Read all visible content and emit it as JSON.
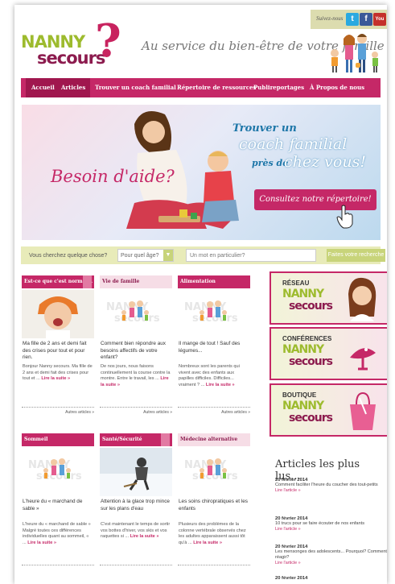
{
  "header": {
    "logo_line1": "NANNY",
    "logo_line2": "secours",
    "logo_mark": "?",
    "tagline": "Au service du bien-être de votre famille",
    "follow_label": "Suivez-nous",
    "social": [
      {
        "icon": "twitter-icon",
        "glyph": "t",
        "color": "#2aa9e0"
      },
      {
        "icon": "facebook-icon",
        "glyph": "f",
        "color": "#3b5998"
      },
      {
        "icon": "youtube-icon",
        "glyph": "You",
        "color": "#c4302b"
      }
    ]
  },
  "nav": {
    "items": [
      "Accueil",
      "Articles",
      "Trouver un coach familial",
      "Répertoire de ressources",
      "Publireportages",
      "À Propos de nous"
    ],
    "active": "Accueil"
  },
  "banner": {
    "headline": "Besoin d'aide?",
    "line1": "Trouver un",
    "line2": "coach familial",
    "line3": "près de",
    "line4": "chez vous!",
    "cta": "Consultez notre répertoire!"
  },
  "search": {
    "label": "Vous cherchez quelque chose?",
    "age_select": "Pour quel âge?",
    "keyword_placeholder": "Un mot en particulier?",
    "button": "Faites votre recherche"
  },
  "cards": [
    {
      "category": "Est-ce que c'est normal...",
      "title": "Ma fille de 2 ans et demi fait des crises pour tout et pour rien.",
      "excerpt": "Bonjour Nanny secours. Ma fille de 2 ans et demi fait des crises pour tout et ...",
      "read_more": "Lire la suite »",
      "more": "Autres articles »",
      "dark": true,
      "flag": true,
      "photo": "child"
    },
    {
      "category": "Vie de famille",
      "title": "Comment bien répondre aux besoins affectifs de votre enfant?",
      "excerpt": "De nos jours, nous faisons continuellement la course contre la montre. Entre le travail, les ...",
      "read_more": "Lire la suite »",
      "more": "Autres articles »",
      "dark": false,
      "flag": false,
      "photo": "logo"
    },
    {
      "category": "Alimentation",
      "title": "Il mange de tout ! Sauf des légumes...",
      "excerpt": "Nombreux sont les parents qui vivent avec des enfants aux papilles difficiles. Difficiles... vraiment ? ...",
      "read_more": "Lire la suite »",
      "more": "Autres articles »",
      "dark": true,
      "flag": false,
      "photo": "logo"
    },
    {
      "category": "Sommeil",
      "title": "L'heure du « marchand de sable »",
      "excerpt": "L'heure du « marchand de sable » Malgré toutes ces différences individuelles quant au sommeil, « ...",
      "read_more": "Lire la suite »",
      "more": "",
      "dark": true,
      "flag": false,
      "photo": "logo"
    },
    {
      "category": "Santé/Sécurité",
      "title": "Attention à la glace trop mince sur les plans d'eau",
      "excerpt": "C'est maintenant le temps de sortir vos bottes d'hiver, vos skis et vos raquettes si ...",
      "read_more": "Lire la suite »",
      "more": "",
      "dark": true,
      "flag": true,
      "photo": "snow"
    },
    {
      "category": "Médecine alternative",
      "title": "Les soins chiropratiques et les enfants",
      "excerpt": "Plusieurs des problèmes de la colonne vertébrale observés chez les adultes apparaissent aussi tôt qu'à ...",
      "read_more": "Lire la suite »",
      "more": "",
      "dark": false,
      "flag": false,
      "photo": "logo"
    }
  ],
  "promos": [
    {
      "top": "RÉSEAU",
      "l1": "NANNY",
      "l2": "secours"
    },
    {
      "top": "CONFÉRENCES",
      "l1": "NANNY",
      "l2": "secours"
    },
    {
      "top": "BOUTIQUE",
      "l1": "NANNY",
      "l2": "secours"
    }
  ],
  "latest": {
    "heading": "Articles les plus lus...",
    "items": [
      {
        "date": "20 février 2014",
        "text": "Comment faciliter l'heure du coucher des tout-petits",
        "read": "Lire l'article »"
      },
      {
        "date": "20 février 2014",
        "text": "10 trucs pour se faire écouter de nos enfants",
        "read": "Lire l'article »"
      },
      {
        "date": "20 février 2014",
        "text": "Les mensonges des adolescents... Pourquoi? Comment réagir?",
        "read": "Lire l'article »"
      },
      {
        "date": "20 février 2014",
        "text": "",
        "read": ""
      }
    ]
  },
  "colors": {
    "brand_pink": "#c52867",
    "brand_green": "#9dbb2e",
    "brand_plum": "#8c1b4e",
    "search_bg": "#e8ebb9"
  }
}
